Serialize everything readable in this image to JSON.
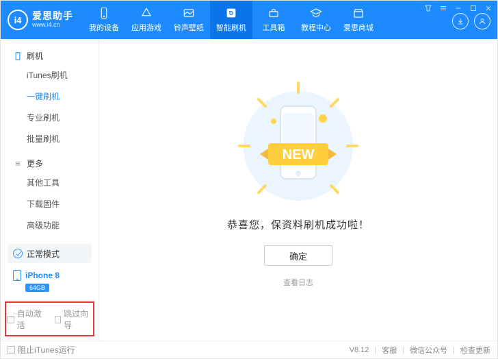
{
  "brand": {
    "logo_text": "i4",
    "title": "爱思助手",
    "url": "www.i4.cn"
  },
  "tabs": [
    {
      "label": "我的设备"
    },
    {
      "label": "应用游戏"
    },
    {
      "label": "铃声壁纸"
    },
    {
      "label": "智能刷机"
    },
    {
      "label": "工具箱"
    },
    {
      "label": "教程中心"
    },
    {
      "label": "爱思商城"
    }
  ],
  "sidebar": {
    "group1": {
      "label": "刷机",
      "items": [
        "iTunes刷机",
        "一键刷机",
        "专业刷机",
        "批量刷机"
      ]
    },
    "group2": {
      "label": "更多",
      "items": [
        "其他工具",
        "下载固件",
        "高级功能"
      ]
    },
    "mode": "正常模式",
    "device": {
      "name": "iPhone 8",
      "storage": "64GB"
    },
    "opts": {
      "auto_activate": "自动激活",
      "skip_guide": "跳过向导"
    }
  },
  "main": {
    "ribbon_text": "NEW",
    "message": "恭喜您，保资料刷机成功啦！",
    "ok_label": "确定",
    "log_label": "查看日志"
  },
  "footer": {
    "block_itunes": "阻止iTunes运行",
    "version": "V8.12",
    "links": [
      "客服",
      "微信公众号",
      "检查更新"
    ]
  }
}
